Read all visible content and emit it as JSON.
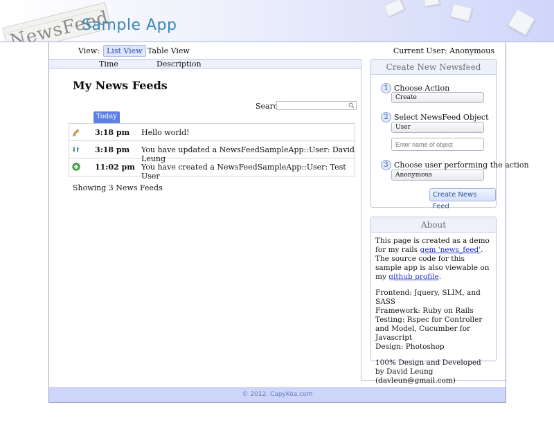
{
  "header": {
    "logo_text": "NewsFeed",
    "app_title": "Sample App"
  },
  "toolbar": {
    "view_label": "View:",
    "list_view": "List View",
    "table_view": "Table View",
    "current_user": "Current User: Anonymous"
  },
  "columns": {
    "time": "Time",
    "description": "Description"
  },
  "main": {
    "title": "My News Feeds",
    "search_label": "Search",
    "search_value": "",
    "group_tab": "Today",
    "feeds": [
      {
        "icon": "pencil-edit-icon",
        "time": "3:18 pm",
        "description": "Hello world!"
      },
      {
        "icon": "update-arrows-icon",
        "time": "3:18 pm",
        "description": "You have updated a NewsFeedSampleApp::User: David Leung"
      },
      {
        "icon": "add-green-icon",
        "time": "11:02 pm",
        "description": "You have created a NewsFeedSampleApp::User: Test User"
      }
    ],
    "showing_text": "Showing 3 News Feeds"
  },
  "create_panel": {
    "title": "Create New Newsfeed",
    "steps": [
      {
        "number": "1",
        "label": "Choose Action",
        "value": "Create"
      },
      {
        "number": "2",
        "label": "Select NewsFeed Object",
        "value": "User"
      },
      {
        "number": "3",
        "label": "Choose user performing the action",
        "value": "Anonymous"
      }
    ],
    "object_name_placeholder": "Enter name of object",
    "submit_label": "Create News Feed"
  },
  "about_panel": {
    "title": "About",
    "p1_a": "This page is created as a demo for my rails ",
    "p1_link1": "gem 'news_feed'",
    "p1_b": ". The source code for this sample app is also viewable on my ",
    "p1_link2": "github profile",
    "p1_c": ".",
    "p2": [
      "Frontend: Jquery, SLIM, and SASS",
      "Framework: Ruby on Rails",
      "Testing: Rspec for Controller and Model, Cucumber for Javascript",
      "Design: Photoshop"
    ],
    "p3": "100% Design and Developed by David Leung (davleun@gmail.com)"
  },
  "footer": {
    "copyright": "© 2012. CapyKoa.com"
  },
  "colors": {
    "accent_blue": "#5d7fe6",
    "title_blue": "#3a86b8",
    "footer_bg": "#cdd5fb"
  }
}
